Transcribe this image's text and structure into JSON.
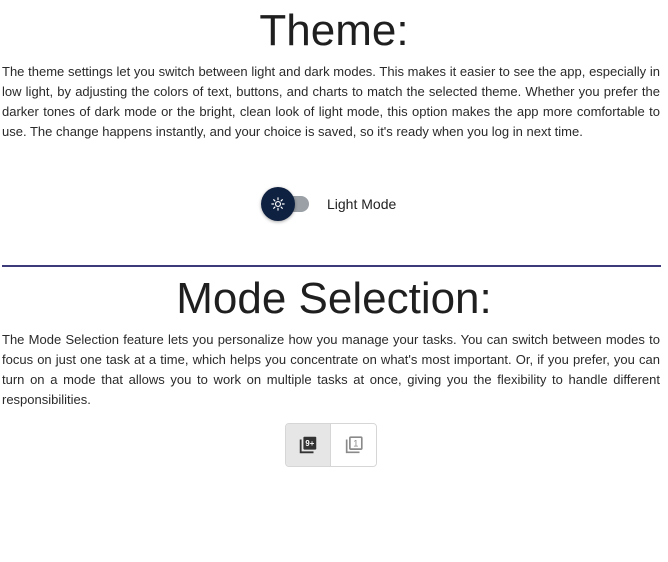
{
  "theme": {
    "title": "Theme:",
    "description": "The theme settings let you switch between light and dark modes. This makes it easier to see the app, especially in low light, by adjusting the colors of text, buttons, and charts to match the selected theme. Whether you prefer the darker tones of dark mode or the bright, clean look of light mode, this option makes the app more comfortable to use. The change happens instantly, and your choice is saved, so it's ready when you log in next time.",
    "toggle": {
      "label": "Light Mode",
      "checked": false,
      "icon": "sun-icon",
      "thumb_color": "#0f2140",
      "track_color": "#9aa0a6"
    }
  },
  "divider_color": "#3d3a7a",
  "mode_selection": {
    "title": "Mode Selection:",
    "description": "The Mode Selection feature lets you personalize how you manage your tasks. You can switch between modes to focus on just one task at a time, which helps you concentrate on what's most important. Or, if you prefer, you can turn on a mode that allows you to work on multiple tasks at once, giving you the flexibility to handle different responsibilities.",
    "options": [
      {
        "icon": "multiple-tasks-icon",
        "glyph": "9+",
        "selected": true
      },
      {
        "icon": "single-task-icon",
        "glyph": "1",
        "selected": false
      }
    ]
  }
}
